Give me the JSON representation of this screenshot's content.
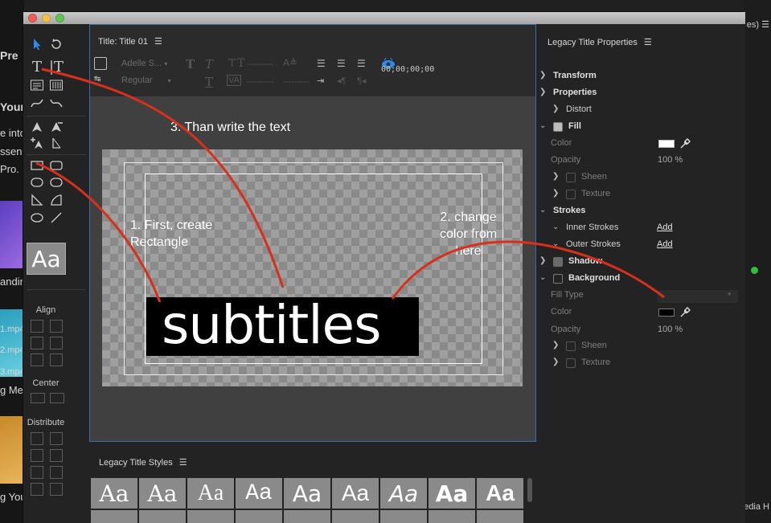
{
  "background_app": {
    "left_texts": [
      "Pre",
      "Your",
      "e into",
      "ssen",
      "Pro.",
      "anding",
      "1.mp4",
      "2.mp4",
      "3.mp4",
      "g Me",
      "g You"
    ],
    "right_texts": [
      "es)",
      "nedia H"
    ]
  },
  "title_panel": {
    "header": "Title: Title 01",
    "toolbar": {
      "font_family": "Adelle S...",
      "font_style": "Regular",
      "timecode": "00;00;00;00"
    }
  },
  "canvas": {
    "subtitle_text": "subtitles",
    "annotation_1": "1. First, create\nRectangle",
    "annotation_2": "2. change\ncolor from\nhere",
    "annotation_3": "3. Than write the text"
  },
  "tools": {
    "preview_text": "Aa",
    "align_label": "Align",
    "center_label": "Center",
    "distribute_label": "Distribute"
  },
  "styles_panel": {
    "header": "Legacy Title Styles",
    "swatches": [
      "Aa",
      "Aa",
      "Aa",
      "Aa",
      "Aa",
      "Aa",
      "Aa",
      "Aa",
      "Aa"
    ]
  },
  "properties": {
    "header": "Legacy Title Properties",
    "transform": "Transform",
    "properties_label": "Properties",
    "distort": "Distort",
    "fill": "Fill",
    "fill_color_label": "Color",
    "fill_color": "#ffffff",
    "fill_opacity_label": "Opacity",
    "fill_opacity": "100 %",
    "sheen": "Sheen",
    "texture": "Texture",
    "strokes": "Strokes",
    "inner_strokes": "Inner Strokes",
    "outer_strokes": "Outer Strokes",
    "add": "Add",
    "shadow": "Shadow",
    "background": "Background",
    "fill_type_label": "Fill Type",
    "bg_color_label": "Color",
    "bg_color": "#000000",
    "bg_opacity_label": "Opacity",
    "bg_opacity": "100 %"
  },
  "colors": {
    "selection_border": "#3a6db0",
    "arrow_red": "#d9301b",
    "accent_blue": "#2d8ceb"
  }
}
